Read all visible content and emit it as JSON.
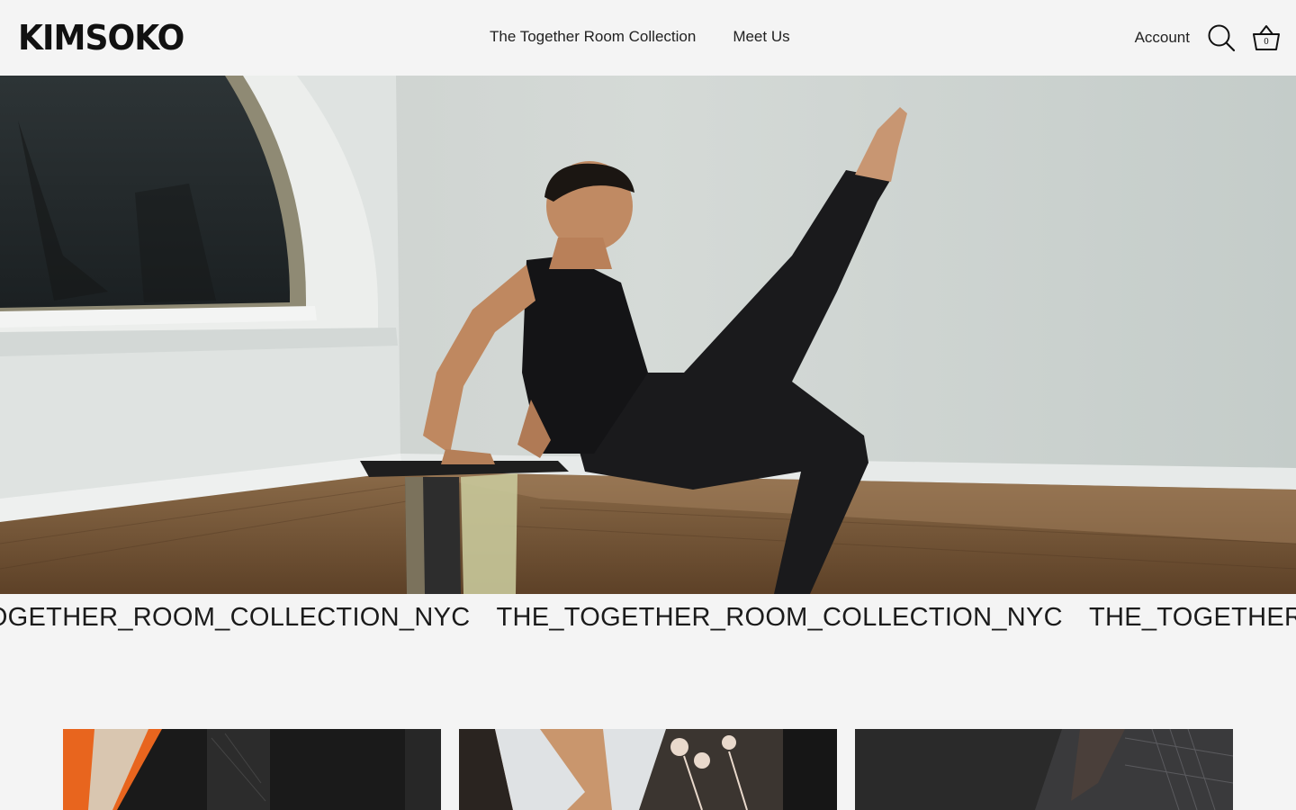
{
  "header": {
    "logo": "KIMSOKO",
    "nav": [
      {
        "label": "The Together Room Collection"
      },
      {
        "label": "Meet Us"
      }
    ],
    "account_label": "Account",
    "search_icon": "search-icon",
    "cart_icon": "basket-icon",
    "cart_count": "0"
  },
  "hero": {
    "image": "person-balancing-on-glass-stool-photo"
  },
  "marquee": {
    "items": [
      "THE_TOGETHER_ROOM_COLLECTION_NYC",
      "THE_TOGETHER_ROOM_COLLECTION_NYC",
      "THE_TOGETHER_ROOM_COLLECTION_NYC"
    ]
  },
  "grid": {
    "cards": [
      {
        "image": "product-photo-orange"
      },
      {
        "image": "product-photo-white-top"
      },
      {
        "image": "product-photo-dark-lace"
      }
    ]
  },
  "colors": {
    "background": "#f4f4f4",
    "text": "#111111"
  }
}
